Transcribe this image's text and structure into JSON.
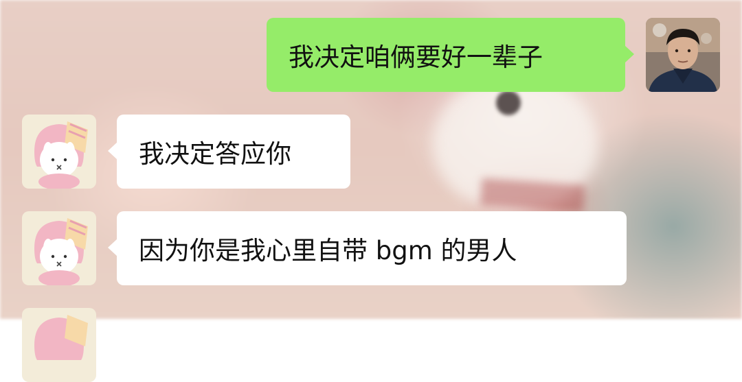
{
  "messages": [
    {
      "sender": "self",
      "text": "我决定咱俩要好一辈子",
      "avatar_icon": "man-portrait-avatar"
    },
    {
      "sender": "other",
      "text": "我决定答应你",
      "avatar_icon": "pink-bunny-hat-avatar"
    },
    {
      "sender": "other",
      "text": "因为你是我心里自带 bgm 的男人",
      "avatar_icon": "pink-bunny-hat-avatar"
    }
  ],
  "colors": {
    "self_bubble": "#95ec69",
    "other_bubble": "#ffffff",
    "text": "#111111"
  }
}
